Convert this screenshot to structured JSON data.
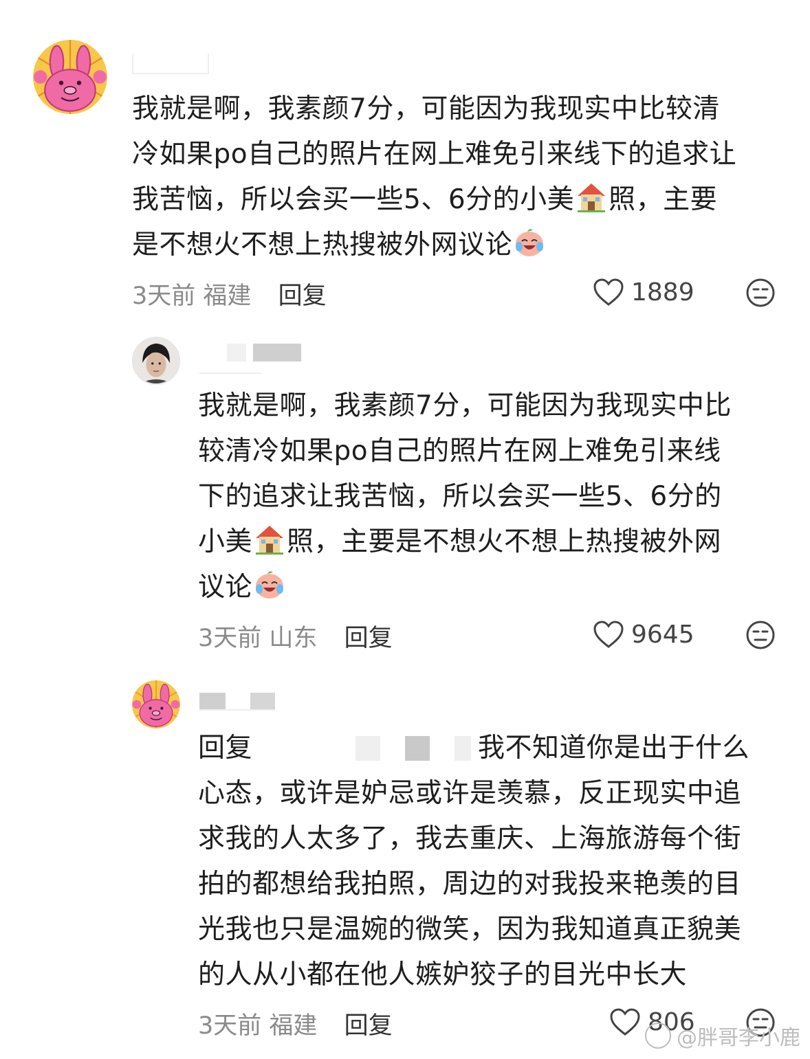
{
  "comments": [
    {
      "avatar": "pink-rabbit-avatar",
      "text_parts": [
        "我就是啊，我素颜7分，可能因为我现实中比较清\n冷如果po自己的照片在网上难免引来线下的追求让\n我苦恼，所以会买一些5、6分的小美",
        "照，主要\n是不想火不想上热搜被外网议论"
      ],
      "time": "3天前",
      "location": "福建",
      "reply_label": "回复",
      "likes": "1889"
    },
    {
      "avatar": "woman-portrait-avatar",
      "text_parts": [
        "我就是啊，我素颜7分，可能因为我现实中比\n较清冷如果po自己的照片在网上难免引来线\n下的追求让我苦恼，所以会买一些5、6分的\n小美",
        "照，主要是不想火不想上热搜被外网\n议论"
      ],
      "time": "3天前",
      "location": "山东",
      "reply_label": "回复",
      "likes": "9645"
    },
    {
      "avatar": "pink-rabbit-avatar",
      "reply_prefix": "回复",
      "text": "我不知道你是出于什么\n心态，或许是妒忌或许是羡慕，反正现实中追\n求我的人太多了，我去重庆、上海旅游每个街\n拍的都想给我拍照，周边的对我投来艳羡的目\n光我也只是温婉的微笑，因为我知道真正貌美\n的人从小都在他人嫉妒狡子的目光中长大",
      "time": "3天前",
      "location": "福建",
      "reply_label": "回复",
      "likes": "806"
    }
  ],
  "watermark": "@胖哥李小鹿",
  "icons": {
    "emoji_house": "house-emoji-icon",
    "emoji_crying": "crying-laugh-emoji-icon",
    "like": "heart-outline-icon",
    "dislike": "dislike-face-icon"
  },
  "colors": {
    "meta_gray": "#8a8a8a",
    "text": "#1e1e1e"
  }
}
